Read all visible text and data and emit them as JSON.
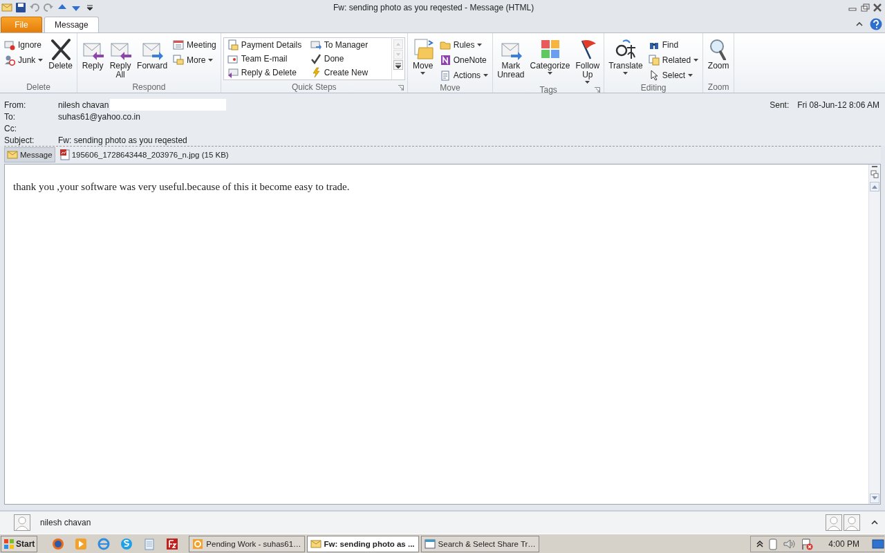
{
  "window": {
    "title": "Fw: sending photo as you reqested  -  Message (HTML)"
  },
  "ribbon": {
    "tabs": [
      {
        "label": "File",
        "kind": "file",
        "selected": false
      },
      {
        "label": "Message",
        "kind": "tab",
        "selected": true
      }
    ],
    "groups": [
      {
        "label": "Delete",
        "launcher": false,
        "items": [
          {
            "kind": "small",
            "label": "Ignore",
            "dropdown": false
          },
          {
            "kind": "small",
            "label": "Junk",
            "dropdown": true
          },
          {
            "kind": "large",
            "label": "Delete",
            "dropdown": false
          }
        ]
      },
      {
        "label": "Respond",
        "launcher": false,
        "items": [
          {
            "kind": "large",
            "label": "Reply",
            "dropdown": false
          },
          {
            "kind": "large",
            "label": "Reply All",
            "dropdown": false
          },
          {
            "kind": "large",
            "label": "Forward",
            "dropdown": false
          },
          {
            "kind": "small",
            "label": "Meeting",
            "dropdown": false
          },
          {
            "kind": "small",
            "label": "More",
            "dropdown": true
          }
        ]
      },
      {
        "label": "Quick Steps",
        "launcher": true,
        "items": [
          {
            "kind": "gallery",
            "label": "Payment Details"
          },
          {
            "kind": "gallery",
            "label": "Team E-mail"
          },
          {
            "kind": "gallery",
            "label": "Reply & Delete"
          },
          {
            "kind": "gallery",
            "label": "To Manager"
          },
          {
            "kind": "gallery",
            "label": "Done"
          },
          {
            "kind": "gallery",
            "label": "Create New"
          }
        ]
      },
      {
        "label": "Move",
        "launcher": false,
        "items": [
          {
            "kind": "large",
            "label": "Move",
            "dropdown": true
          },
          {
            "kind": "small",
            "label": "Rules",
            "dropdown": true
          },
          {
            "kind": "small",
            "label": "OneNote",
            "dropdown": false
          },
          {
            "kind": "small",
            "label": "Actions",
            "dropdown": true
          }
        ]
      },
      {
        "label": "Tags",
        "launcher": true,
        "items": [
          {
            "kind": "large",
            "label": "Mark Unread",
            "dropdown": false
          },
          {
            "kind": "large",
            "label": "Categorize",
            "dropdown": true
          },
          {
            "kind": "large",
            "label": "Follow Up",
            "dropdown": true
          }
        ]
      },
      {
        "label": "Editing",
        "launcher": false,
        "items": [
          {
            "kind": "large",
            "label": "Translate",
            "dropdown": true
          },
          {
            "kind": "small",
            "label": "Find",
            "dropdown": false
          },
          {
            "kind": "small",
            "label": "Related",
            "dropdown": true
          },
          {
            "kind": "small",
            "label": "Select",
            "dropdown": true
          }
        ]
      },
      {
        "label": "Zoom",
        "launcher": false,
        "items": [
          {
            "kind": "large",
            "label": "Zoom",
            "dropdown": false
          }
        ]
      }
    ]
  },
  "header": {
    "fields": [
      {
        "label": "From:",
        "value": "nilesh chavan",
        "redacted": true
      },
      {
        "label": "To:",
        "value": "suhas61@yahoo.co.in",
        "redacted": false
      },
      {
        "label": "Cc:",
        "redacted": false
      },
      {
        "label": "Subject:",
        "value": "Fw: sending photo as you reqested",
        "redacted": false
      }
    ],
    "sent": {
      "label": "Sent:",
      "value": "Fri 08-Jun-12 8:06 AM"
    }
  },
  "attachments": [
    {
      "kind": "message",
      "label": "Message",
      "selected": true
    },
    {
      "kind": "file",
      "label": "195606_1728643448_203976_n.jpg (15 KB)",
      "selected": false
    }
  ],
  "body": {
    "text": "thank you ,your software was very useful.because of this it become easy to trade."
  },
  "people_pane": {
    "name": "nilesh chavan"
  },
  "taskbar": {
    "start": "Start",
    "tasks": [
      {
        "label": "Pending Work - suhas61…",
        "kind": "outlook",
        "selected": false
      },
      {
        "label": "Fw: sending photo as ...",
        "kind": "message",
        "selected": true
      },
      {
        "label": "Search & Select Share Tr…",
        "kind": "app",
        "selected": false
      }
    ],
    "clock": "4:00 PM"
  }
}
